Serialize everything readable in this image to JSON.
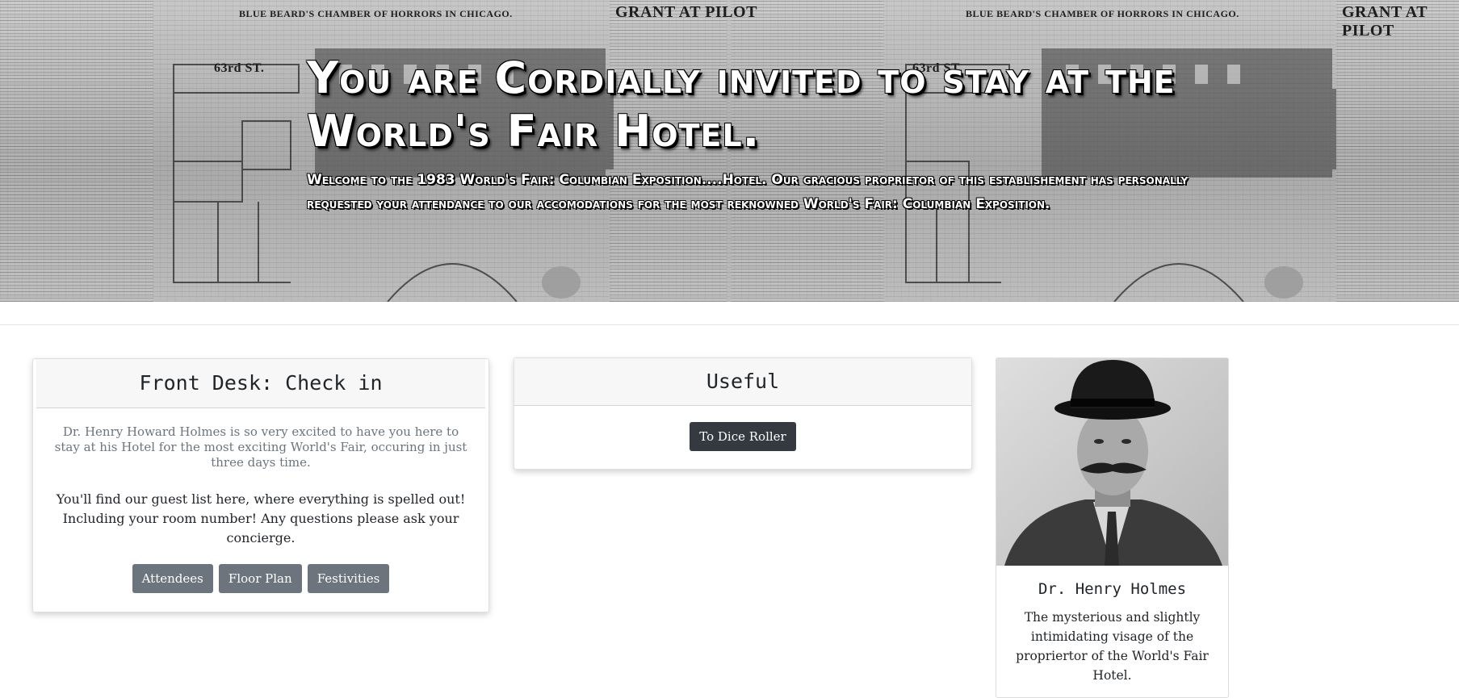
{
  "hero": {
    "title": "You are Cordially invited to stay at the World's Fair Hotel.",
    "subtitle": "Welcome to the 1983 World's Fair: Columbian Exposition....Hotel. Our gracious proprietor of this establishement has personally requested your attendance to our accomodations for the most reknowned World's Fair: Columbian Exposition.",
    "newspaper_headline": "BLUE BEARD'S CHAMBER OF HORRORS IN CHICAGO.",
    "column_headline": "GRANT AT PILOT",
    "street_label": "63rd ST."
  },
  "checkin": {
    "title": "Front Desk: Check in",
    "intro": "Dr. Henry Howard Holmes is so very excited to have you here to stay at his Hotel for the most exciting World's Fair, occuring in just three days time.",
    "body": "You'll find our guest list here, where everything is spelled out! Including your room number! Any questions please ask your concierge.",
    "buttons": [
      "Attendees",
      "Floor Plan",
      "Festivities"
    ]
  },
  "useful": {
    "title": "Useful",
    "button": "To Dice Roller"
  },
  "profile": {
    "name": "Dr. Henry Holmes",
    "description": "The mysterious and slightly intimidating visage of the propriertor of the World's Fair Hotel."
  }
}
